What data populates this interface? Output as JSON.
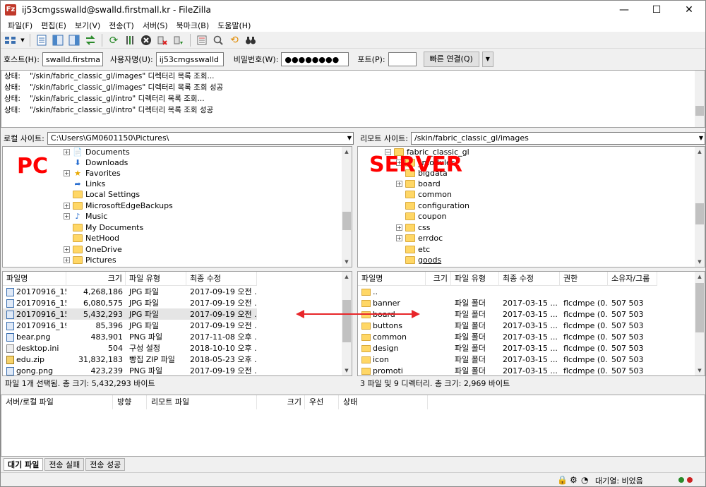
{
  "title": "ij53cmgsswalld@swalld.firstmall.kr - FileZilla",
  "window_controls": {
    "minimize": "—",
    "maximize": "☐",
    "close": "✕"
  },
  "menu": [
    "파일(F)",
    "편집(E)",
    "보기(V)",
    "전송(T)",
    "서버(S)",
    "북마크(B)",
    "도움말(H)"
  ],
  "quickconnect": {
    "host_label": "호스트(H):",
    "host_value": "swalld.firstmall.kr",
    "user_label": "사용자명(U):",
    "user_value": "ij53cmgsswalld",
    "pass_label": "비밀번호(W):",
    "pass_value": "●●●●●●●●",
    "port_label": "포트(P):",
    "port_value": "",
    "connect_label": "빠른 연결(Q)"
  },
  "log": [
    {
      "k": "상태:",
      "v": "\"/skin/fabric_classic_gl/images\" 디렉터리 목록 조회..."
    },
    {
      "k": "상태:",
      "v": "\"/skin/fabric_classic_gl/images\" 디렉터리 목록 조회 성공"
    },
    {
      "k": "상태:",
      "v": "\"/skin/fabric_classic_gl/intro\" 디렉터리 목록 조회..."
    },
    {
      "k": "상태:",
      "v": "\"/skin/fabric_classic_gl/intro\" 디렉터리 목록 조회 성공"
    }
  ],
  "local": {
    "site_label": "로컬 사이트:",
    "path": "C:\\Users\\GM0601150\\Pictures\\",
    "tree": [
      "Documents",
      "Downloads",
      "Favorites",
      "Links",
      "Local Settings",
      "MicrosoftEdgeBackups",
      "Music",
      "My Documents",
      "NetHood",
      "OneDrive",
      "Pictures"
    ],
    "columns": [
      "파일명",
      "크기",
      "파일 유형",
      "최종 수정"
    ],
    "files": [
      {
        "name": "20170916_150...",
        "size": "4,268,186",
        "type": "JPG 파일",
        "mod": "2017-09-19 오전 ..."
      },
      {
        "name": "20170916_150...",
        "size": "6,080,575",
        "type": "JPG 파일",
        "mod": "2017-09-19 오전 ..."
      },
      {
        "name": "20170916_151...",
        "size": "5,432,293",
        "type": "JPG 파일",
        "mod": "2017-09-19 오전 ..."
      },
      {
        "name": "20170916_190...",
        "size": "85,396",
        "type": "JPG 파일",
        "mod": "2017-09-19 오전 ..."
      },
      {
        "name": "bear.png",
        "size": "483,901",
        "type": "PNG 파일",
        "mod": "2017-11-08 오후 ..."
      },
      {
        "name": "desktop.ini",
        "size": "504",
        "type": "구성 설정",
        "mod": "2018-10-10 오후 ..."
      },
      {
        "name": "edu.zip",
        "size": "31,832,183",
        "type": "빵집 ZIP 파일",
        "mod": "2018-05-23 오후 ..."
      },
      {
        "name": "gong.png",
        "size": "423,239",
        "type": "PNG 파일",
        "mod": "2017-09-19 오전 ..."
      }
    ],
    "status": "파일 1개 선택됨. 총 크기: 5,432,293 바이트",
    "overlay": "PC"
  },
  "remote": {
    "site_label": "리모트 사이트:",
    "path": "/skin/fabric_classic_gl/images",
    "tree": [
      "fabric_classic_gl",
      "_modules",
      "bigdata",
      "board",
      "common",
      "configuration",
      "coupon",
      "css",
      "errdoc",
      "etc",
      "goods"
    ],
    "columns": [
      "파일명",
      "크기",
      "파일 유형",
      "최종 수정",
      "권한",
      "소유자/그룹"
    ],
    "files": [
      {
        "name": "..",
        "type": "",
        "mod": "",
        "perm": "",
        "owner": ""
      },
      {
        "name": "banner",
        "type": "파일 폴더",
        "mod": "2017-03-15 ...",
        "perm": "flcdmpe (0...",
        "owner": "507 503"
      },
      {
        "name": "board",
        "type": "파일 폴더",
        "mod": "2017-03-15 ...",
        "perm": "flcdmpe (0...",
        "owner": "507 503"
      },
      {
        "name": "buttons",
        "type": "파일 폴더",
        "mod": "2017-03-15 ...",
        "perm": "flcdmpe (0...",
        "owner": "507 503"
      },
      {
        "name": "common",
        "type": "파일 폴더",
        "mod": "2017-03-15 ...",
        "perm": "flcdmpe (0...",
        "owner": "507 503"
      },
      {
        "name": "design",
        "type": "파일 폴더",
        "mod": "2017-03-15 ...",
        "perm": "flcdmpe (0...",
        "owner": "507 503"
      },
      {
        "name": "icon",
        "type": "파일 폴더",
        "mod": "2017-03-15 ...",
        "perm": "flcdmpe (0...",
        "owner": "507 503"
      },
      {
        "name": "promoti",
        "type": "파일 폴더",
        "mod": "2017-03-15 ...",
        "perm": "flcdmpe (0...",
        "owner": "507 503"
      }
    ],
    "status": "3 파일 및 9 디렉터리. 총 크기: 2,969 바이트",
    "overlay": "SERVER"
  },
  "queue": {
    "columns": [
      "서버/로컬 파일",
      "방향",
      "리모트 파일",
      "크기",
      "우선",
      "상태"
    ],
    "tabs": [
      "대기 파일",
      "전송 실패",
      "전송 성공"
    ]
  },
  "statusbar": {
    "queue": "대기열: 비었음"
  },
  "colors": {
    "overlay": "#ff0000",
    "arrow": "#e8262a",
    "folder": "#ffd766"
  }
}
